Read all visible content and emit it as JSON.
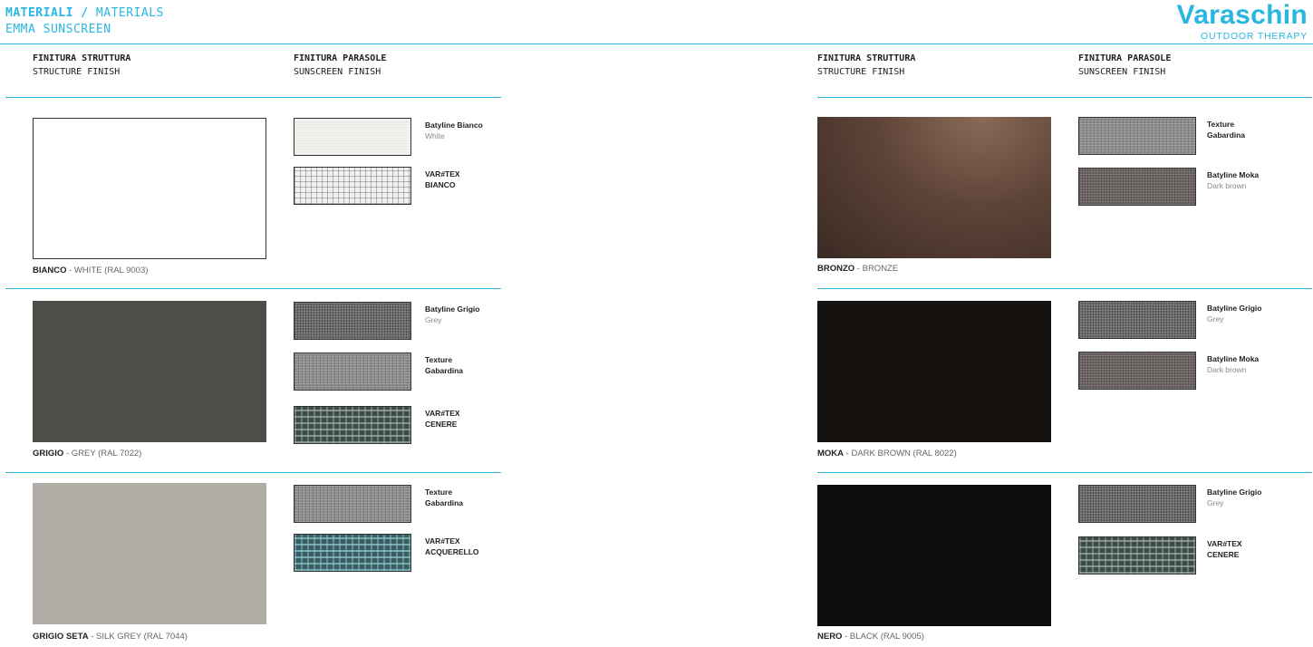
{
  "header": {
    "title_bold": "MATERIALI /",
    "title_light": "MATERIALS",
    "subtitle": "EMMA SUNSCREEN",
    "brand_name": "Varaschin",
    "brand_tagline": "OUTDOOR THERAPY"
  },
  "column_headers": {
    "structure_it": "FINITURA STRUTTURA",
    "structure_en": "STRUCTURE FINISH",
    "sunscreen_it": "FINITURA PARASOLE",
    "sunscreen_en": "SUNSCREEN FINISH"
  },
  "left_page": [
    {
      "finish_name": "BIANCO",
      "finish_desc": " - WHITE (RAL 9003)",
      "color": "#ffffff",
      "fabrics": [
        {
          "name": "Batyline Bianco",
          "sub": "White",
          "pattern": "white"
        },
        {
          "name": "VAR#TEX",
          "sub_bold": "BIANCO",
          "pattern": "vartex-white"
        }
      ]
    },
    {
      "finish_name": "GRIGIO",
      "finish_desc": " - GREY  (RAL 7022)",
      "color": "#4d4e48",
      "fabrics": [
        {
          "name": "Batyline Grigio",
          "sub": "Grey",
          "pattern": "grey"
        },
        {
          "name": "Texture",
          "sub_bold": "Gabardina",
          "pattern": "gabardina"
        },
        {
          "name": "VAR#TEX",
          "sub_bold": "CENERE",
          "pattern": "cenere"
        }
      ]
    },
    {
      "finish_name": "GRIGIO SETA",
      "finish_desc": " - SILK GREY (RAL 7044)",
      "color": "#b1ada6",
      "fabrics": [
        {
          "name": "Texture",
          "sub_bold": "Gabardina",
          "pattern": "gabardina"
        },
        {
          "name": "VAR#TEX",
          "sub_bold": "ACQUERELLO",
          "pattern": "acquerello"
        }
      ]
    }
  ],
  "right_page": [
    {
      "finish_name": "BRONZO",
      "finish_desc": " - BRONZE",
      "color": "#5a4035",
      "fabrics": [
        {
          "name": "Texture",
          "sub_bold": "Gabardina",
          "pattern": "gabardina"
        },
        {
          "name": "Batyline Moka",
          "sub": "Dark brown",
          "pattern": "moka"
        }
      ]
    },
    {
      "finish_name": "MOKA",
      "finish_desc": " - DARK BROWN (RAL 8022)",
      "color": "#151210",
      "fabrics": [
        {
          "name": "Batyline Grigio",
          "sub": "Grey",
          "pattern": "grey"
        },
        {
          "name": "Batyline Moka",
          "sub": "Dark brown",
          "pattern": "moka"
        }
      ]
    },
    {
      "finish_name": "NERO",
      "finish_desc": " - BLACK (RAL 9005)",
      "color": "#0d0d0f",
      "fabrics": [
        {
          "name": "Batyline Grigio",
          "sub": "Grey",
          "pattern": "grey"
        },
        {
          "name": "VAR#TEX",
          "sub_bold": "CENERE",
          "pattern": "cenere"
        }
      ]
    }
  ]
}
